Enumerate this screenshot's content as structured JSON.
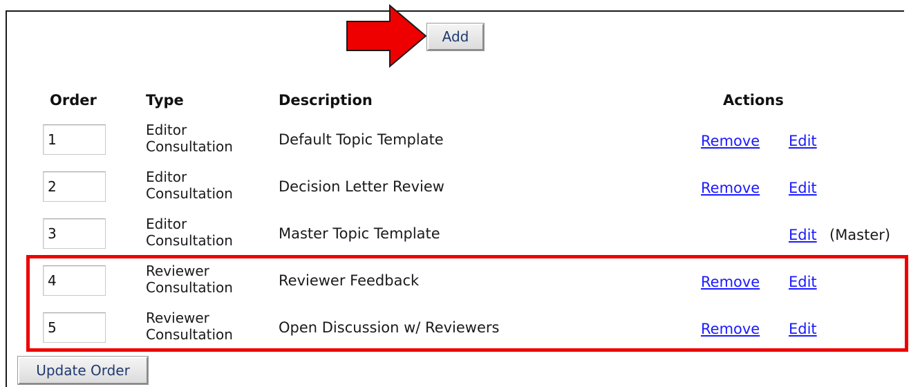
{
  "toolbar": {
    "add_label": "Add",
    "update_order_label": "Update Order"
  },
  "table": {
    "headers": {
      "order": "Order",
      "type": "Type",
      "description": "Description",
      "actions": "Actions"
    },
    "rows": [
      {
        "order": "1",
        "type_line1": "Editor",
        "type_line2": "Consultation",
        "description": "Default Topic Template",
        "remove": "Remove",
        "edit": "Edit",
        "note": ""
      },
      {
        "order": "2",
        "type_line1": "Editor",
        "type_line2": "Consultation",
        "description": "Decision Letter Review",
        "remove": "Remove",
        "edit": "Edit",
        "note": ""
      },
      {
        "order": "3",
        "type_line1": "Editor",
        "type_line2": "Consultation",
        "description": "Master Topic Template",
        "remove": "",
        "edit": "Edit",
        "note": "(Master)"
      },
      {
        "order": "4",
        "type_line1": "Reviewer",
        "type_line2": "Consultation",
        "description": "Reviewer Feedback",
        "remove": "Remove",
        "edit": "Edit",
        "note": ""
      },
      {
        "order": "5",
        "type_line1": "Reviewer",
        "type_line2": "Consultation",
        "description": "Open Discussion w/ Reviewers",
        "remove": "Remove",
        "edit": "Edit",
        "note": ""
      }
    ]
  },
  "colors": {
    "annotation": "#ee0000",
    "link": "#1a1aff",
    "button_text": "#1f3a6e"
  },
  "icons": {
    "annotation_arrow": "red-arrow-icon"
  }
}
